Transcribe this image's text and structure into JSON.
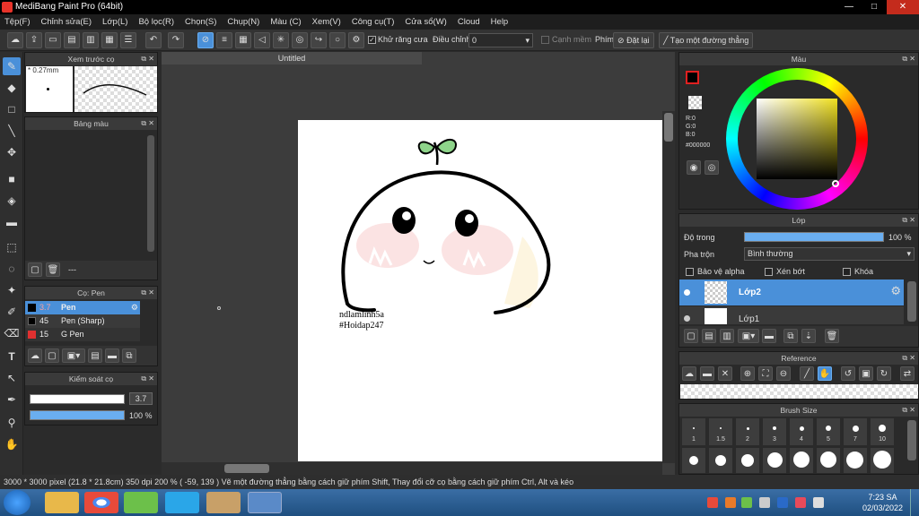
{
  "window": {
    "title": "MediBang Paint Pro (64bit)",
    "min": "—",
    "max": "□",
    "close": "✕"
  },
  "menu": [
    "Tệp(F)",
    "Chỉnh sửa(E)",
    "Lớp(L)",
    "Bộ lọc(R)",
    "Chọn(S)",
    "Chụp(N)",
    "Màu (C)",
    "Xem(V)",
    "Công cụ(T)",
    "Cửa sổ(W)",
    "Cloud",
    "Help"
  ],
  "toolbar": {
    "antialias_label": "Khử răng cưa",
    "adjust_label": "Điều chỉnh",
    "adjust_value": "0",
    "edge_label": "Cạnh mềm",
    "key_label": "Phím",
    "reset_label": "Đặt lại",
    "line_label": "Tạo một đường thẳng"
  },
  "brush_preview": {
    "title": "Xem trước cọ",
    "size": "* 0.27mm"
  },
  "palette": {
    "title": "Bảng màu",
    "dash": "---"
  },
  "brush_panel": {
    "title": "Cọ: Pen",
    "items": [
      {
        "num": "3.7",
        "name": "Pen",
        "color": "#000000",
        "selected": true
      },
      {
        "num": "45",
        "name": "Pen (Sharp)",
        "color": "#000000",
        "selected": false
      },
      {
        "num": "15",
        "name": "G Pen",
        "color": "#e03030",
        "selected": false
      }
    ]
  },
  "brush_control": {
    "title": "Kiểm soát cọ",
    "size": "3.7",
    "opacity": "100 %",
    "size_frac": 1.0,
    "opacity_frac": 1.0
  },
  "canvas": {
    "tab": "Untitled",
    "watermark_line1": "ndlamlinh5a",
    "watermark_line2": "#Hoidap247"
  },
  "color_panel": {
    "title": "Màu",
    "r": "R:0",
    "g": "G:0",
    "b": "B:0",
    "hex": "#000000"
  },
  "layer_panel": {
    "title": "Lớp",
    "opacity_label": "Độ trong",
    "opacity_value": "100 %",
    "blend_label": "Pha trộn",
    "blend_value": "Bình thường",
    "protect_alpha": "Bảo vệ alpha",
    "clipping": "Xén bớt",
    "lock": "Khóa",
    "layers": [
      "Lớp2",
      "Lớp1"
    ]
  },
  "reference_panel": {
    "title": "Reference"
  },
  "brush_size_panel": {
    "title": "Brush Size",
    "sizes": [
      "1",
      "1.5",
      "2",
      "3",
      "4",
      "5",
      "7",
      "10"
    ]
  },
  "status": {
    "text": "3000 * 3000 pixel   (21.8 * 21.8cm)   350 dpi   200 %   ( -59, 139 )   Vẽ một đường thẳng bằng cách giữ phím Shift, Thay đổi cỡ cọ bằng cách giữ phím Ctrl, Alt và kéo"
  },
  "clock": {
    "time": "7:23 SA",
    "date": "02/03/2022"
  }
}
